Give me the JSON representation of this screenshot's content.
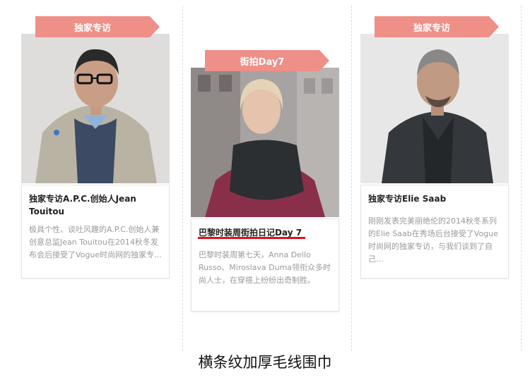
{
  "cards": [
    {
      "tag": "独家专访",
      "title": "独家专访A.P.C.创始人Jean Touitou",
      "desc": "极具个性、谈吐风趣的A.P.C.创始人兼创意总监Jean Touitou在2014秋冬发布会后接受了Vogue时尚网的独家专..."
    },
    {
      "tag": "街拍Day7",
      "title": "巴黎时装周街拍日记Day 7",
      "desc": "巴黎时装周第七天，Anna Dello Russo、Miroslava Duma领衔众多时尚人士，在穿搭上纷纷出奇制胜。"
    },
    {
      "tag": "独家专访",
      "title": "独家专访Elie Saab",
      "desc": "刚刚发表完美丽绝伦的2014秋冬系列的Elie Saab在秀场后台接受了Vogue时尚网的独家专访，与我们谈到了自己..."
    }
  ],
  "caption": "横条纹加厚毛线围巾",
  "colors": {
    "tag": "#ee8f88",
    "highlight_underline": "#e0101a"
  }
}
